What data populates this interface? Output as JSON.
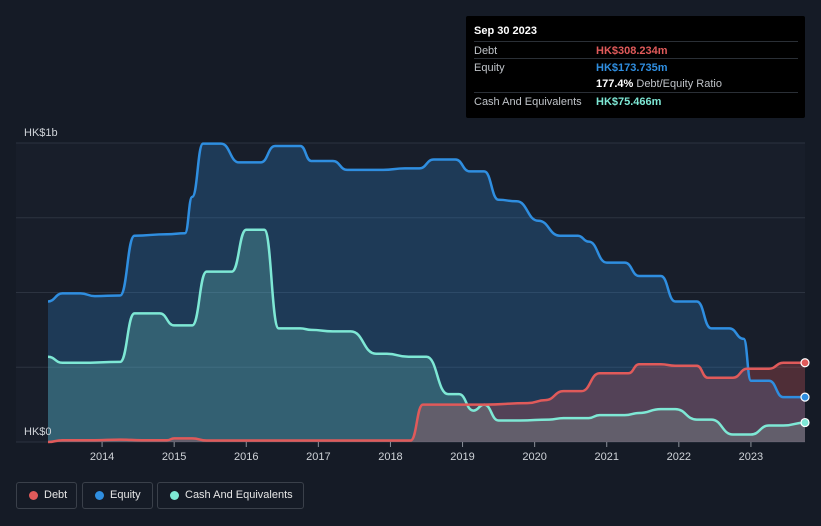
{
  "chart_data": {
    "type": "area",
    "y_axis": {
      "top_label": "HK$1b",
      "bottom_label": "HK$0",
      "ylim": [
        0,
        1000
      ]
    },
    "x_ticks": [
      "2014",
      "2015",
      "2016",
      "2017",
      "2018",
      "2019",
      "2020",
      "2021",
      "2022",
      "2023"
    ],
    "grid": true,
    "series": [
      {
        "name": "Equity",
        "color": "#2f8ee0",
        "x": [
          2013.25,
          2013.45,
          2013.7,
          2013.9,
          2014.25,
          2014.45,
          2014.9,
          2015.15,
          2015.25,
          2015.4,
          2015.65,
          2015.9,
          2016.2,
          2016.4,
          2016.75,
          2016.9,
          2017.2,
          2017.4,
          2017.9,
          2018.2,
          2018.4,
          2018.6,
          2018.9,
          2019.1,
          2019.3,
          2019.5,
          2019.75,
          2020.05,
          2020.35,
          2020.6,
          2020.75,
          2021.0,
          2021.25,
          2021.45,
          2021.75,
          2021.95,
          2022.25,
          2022.45,
          2022.7,
          2022.9,
          2023.0,
          2023.25,
          2023.45,
          2023.75
        ],
        "values": [
          470,
          497,
          497,
          488,
          490,
          690,
          695,
          698,
          820,
          998,
          998,
          935,
          935,
          990,
          990,
          940,
          940,
          910,
          910,
          915,
          915,
          945,
          945,
          905,
          905,
          810,
          805,
          740,
          690,
          690,
          670,
          600,
          600,
          555,
          555,
          470,
          470,
          380,
          380,
          345,
          205,
          205,
          150,
          150
        ]
      },
      {
        "name": "Cash And Equivalents",
        "color": "#7ee8d5",
        "x": [
          2013.25,
          2013.45,
          2013.7,
          2014.25,
          2014.45,
          2014.8,
          2015.0,
          2015.25,
          2015.45,
          2015.8,
          2016.0,
          2016.25,
          2016.45,
          2016.75,
          2016.9,
          2017.2,
          2017.45,
          2017.8,
          2017.95,
          2018.25,
          2018.5,
          2018.8,
          2018.95,
          2019.15,
          2019.3,
          2019.5,
          2019.8,
          2020.2,
          2020.4,
          2020.75,
          2020.9,
          2021.25,
          2021.45,
          2021.75,
          2021.95,
          2022.25,
          2022.45,
          2022.75,
          2022.9,
          2023.0,
          2023.25,
          2023.45,
          2023.75
        ],
        "values": [
          285,
          265,
          265,
          268,
          430,
          430,
          390,
          390,
          570,
          570,
          710,
          710,
          380,
          380,
          375,
          370,
          370,
          295,
          295,
          285,
          285,
          160,
          160,
          105,
          125,
          72,
          72,
          75,
          80,
          80,
          90,
          90,
          97,
          110,
          110,
          75,
          75,
          25,
          25,
          25,
          55,
          55,
          65
        ]
      },
      {
        "name": "Debt",
        "color": "#e05a5a",
        "x": [
          2013.25,
          2013.45,
          2013.9,
          2014.25,
          2014.55,
          2014.9,
          2015.0,
          2015.25,
          2015.45,
          2016.0,
          2017.9,
          2018.2,
          2018.28,
          2018.45,
          2018.8,
          2019.0,
          2019.3,
          2019.9,
          2020.15,
          2020.4,
          2020.65,
          2020.9,
          2021.0,
          2021.3,
          2021.45,
          2021.75,
          2021.95,
          2022.25,
          2022.4,
          2022.75,
          2022.95,
          2023.05,
          2023.25,
          2023.45,
          2023.75
        ],
        "values": [
          0,
          6,
          6,
          8,
          6,
          6,
          12,
          12,
          5,
          5,
          5,
          5,
          5,
          125,
          125,
          125,
          125,
          130,
          140,
          170,
          170,
          230,
          230,
          230,
          260,
          260,
          255,
          255,
          215,
          215,
          245,
          245,
          245,
          265,
          265
        ]
      }
    ]
  },
  "tooltip": {
    "date": "Sep 30 2023",
    "debt_label": "Debt",
    "debt_value": "HK$308.234m",
    "equity_label": "Equity",
    "equity_value": "HK$173.735m",
    "ratio_value": "177.4%",
    "ratio_label": "Debt/Equity Ratio",
    "cash_label": "Cash And Equivalents",
    "cash_value": "HK$75.466m"
  },
  "legend": [
    {
      "label": "Debt",
      "color": "#e05a5a"
    },
    {
      "label": "Equity",
      "color": "#2f8ee0"
    },
    {
      "label": "Cash And Equivalents",
      "color": "#7ee8d5"
    }
  ],
  "colors": {
    "background": "#151b26",
    "plot_background": "#181e2a",
    "grid": "#2c3340",
    "tooltip_bg": "#000000"
  }
}
